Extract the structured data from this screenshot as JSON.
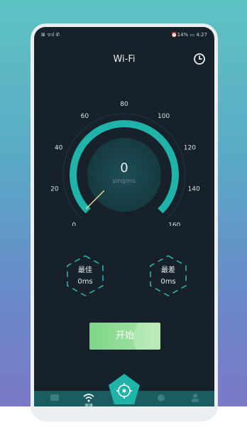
{
  "status_bar": {
    "left": "⊠ ᯤıl ✆",
    "right": "⏰14% ▭ 4:27"
  },
  "header": {
    "title": "Wi-Fi"
  },
  "gauge": {
    "min": 0,
    "max": 160,
    "ticks": [
      "0",
      "20",
      "40",
      "60",
      "80",
      "100",
      "120",
      "140",
      "160"
    ],
    "value": "0",
    "unit": "ping/ms",
    "accent": "#1fb3aa"
  },
  "stats": {
    "best_label": "最佳",
    "best_value": "0ms",
    "worst_label": "最差",
    "worst_value": "0ms"
  },
  "start_button": {
    "label": "开始"
  },
  "tabbar": {
    "active_label": "测速",
    "accent": "#1a5c60"
  }
}
